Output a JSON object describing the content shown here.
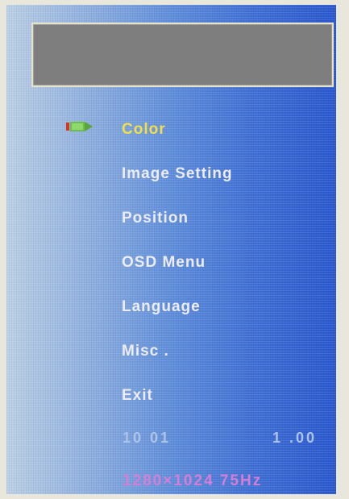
{
  "title_box": {
    "text": ""
  },
  "menu": {
    "items": [
      {
        "label": "Color",
        "selected": true
      },
      {
        "label": "Image  Setting",
        "selected": false
      },
      {
        "label": "Position",
        "selected": false
      },
      {
        "label": "OSD  Menu",
        "selected": false
      },
      {
        "label": "Language",
        "selected": false
      },
      {
        "label": "Misc .",
        "selected": false
      },
      {
        "label": "Exit",
        "selected": false
      }
    ],
    "pointer_icon": "selection-arrow-icon"
  },
  "footer": {
    "version_left": "10  01",
    "version_right": "1 .00",
    "resolution": "1280×1024  75Hz"
  },
  "colors": {
    "selected_text": "#f2e04a",
    "menu_text": "#ececf4",
    "resolution_text": "#d67ed4",
    "title_box_fill": "#7e7e7e"
  }
}
